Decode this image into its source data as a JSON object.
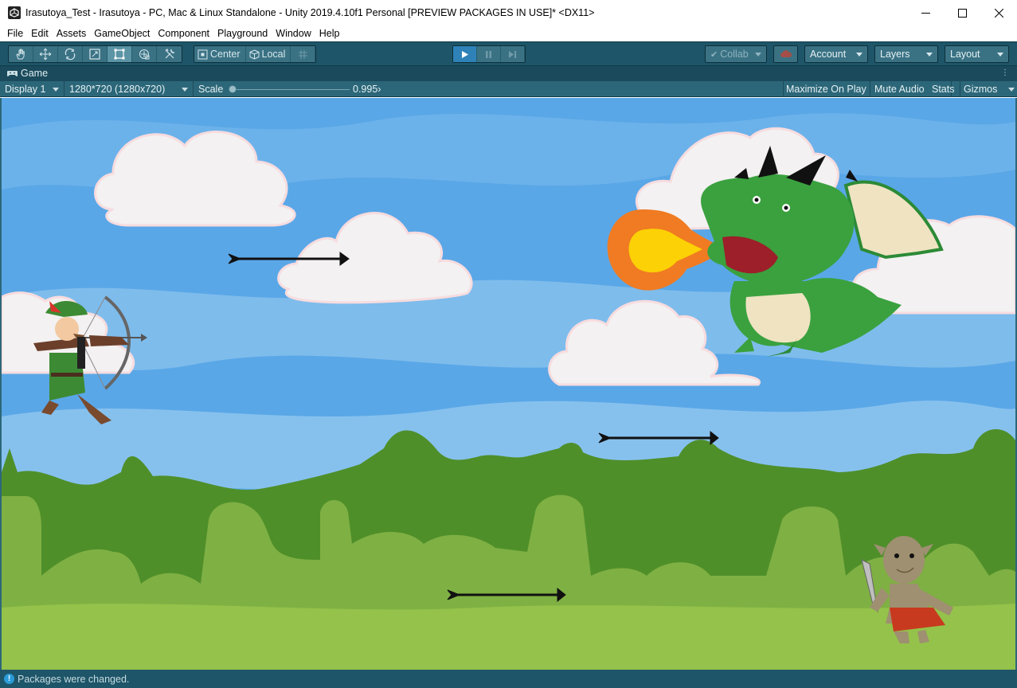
{
  "window": {
    "title": "Irasutoya_Test - Irasutoya - PC, Mac & Linux Standalone - Unity 2019.4.10f1 Personal [PREVIEW PACKAGES IN USE]* <DX11>",
    "icon": "unity-logo-icon",
    "controls": [
      "minimize-icon",
      "maximize-icon",
      "close-icon"
    ]
  },
  "menu": {
    "items": [
      "File",
      "Edit",
      "Assets",
      "GameObject",
      "Component",
      "Playground",
      "Window",
      "Help"
    ]
  },
  "toolbar": {
    "transform_tools": [
      "hand-icon",
      "move-icon",
      "rotate-icon",
      "scale-icon",
      "rect-icon",
      "transform-icon",
      "custom-tool-icon"
    ],
    "active_tool": "rect-icon",
    "pivot_label": "Center",
    "space_label": "Local",
    "snap_icon": "grid-snap-icon",
    "play_state": "playing",
    "collab_label": "Collab",
    "account_label": "Account",
    "layers_label": "Layers",
    "layout_label": "Layout"
  },
  "tab": {
    "label": "Game",
    "icon": "gamepad-icon"
  },
  "gamebar": {
    "display": "Display 1",
    "resolution": "1280*720 (1280x720)",
    "scale_label": "Scale",
    "scale_value": "0.995",
    "maximize_on_play": "Maximize On Play",
    "mute_audio": "Mute Audio",
    "stats": "Stats",
    "gizmos": "Gizmos"
  },
  "game": {
    "sprites": [
      "archer",
      "dragon",
      "fireball",
      "goblin",
      "arrow",
      "arrow",
      "arrow",
      "cloud",
      "cloud",
      "cloud",
      "cloud",
      "cloud",
      "cloud"
    ],
    "colors": {
      "sky": "#5aa7e7",
      "sky_band": "#7ebcec",
      "hill_dark": "#4f8f2a",
      "hill_light": "#7fb043",
      "ground": "#94c24a"
    }
  },
  "status": {
    "icon": "info-icon",
    "message": "Packages were changed."
  }
}
